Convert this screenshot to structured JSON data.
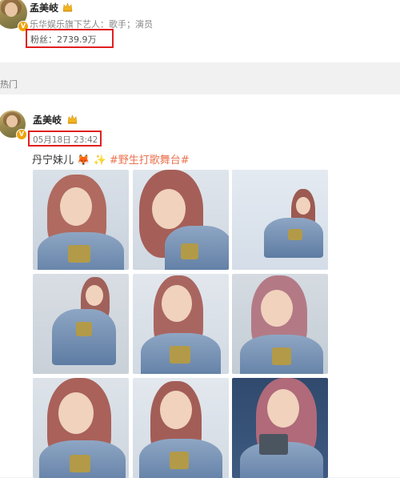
{
  "profile": {
    "name": "孟美岐",
    "subtitle": "乐华娱乐旗下艺人：歌手；演员",
    "fans": "粉丝：2739.9万",
    "badge_glyph": "V"
  },
  "section": {
    "label": "热门"
  },
  "post": {
    "name": "孟美岐",
    "timestamp": "05月18日 23:42",
    "text": "丹宁妹儿",
    "fox_emoji": "🦊",
    "sparkle_emoji": "✨",
    "hashtag": "#野生打歌舞台#",
    "badge_glyph": "V",
    "photo_count": 9
  },
  "colors": {
    "highlight_border": "#e02020",
    "hashtag": "#eb7350",
    "badge": "#f0a30a"
  },
  "icons": {
    "crown": "crown-icon",
    "verified": "verified-icon",
    "fox": "fox-emoji",
    "sparkle": "sparkle-emoji"
  }
}
